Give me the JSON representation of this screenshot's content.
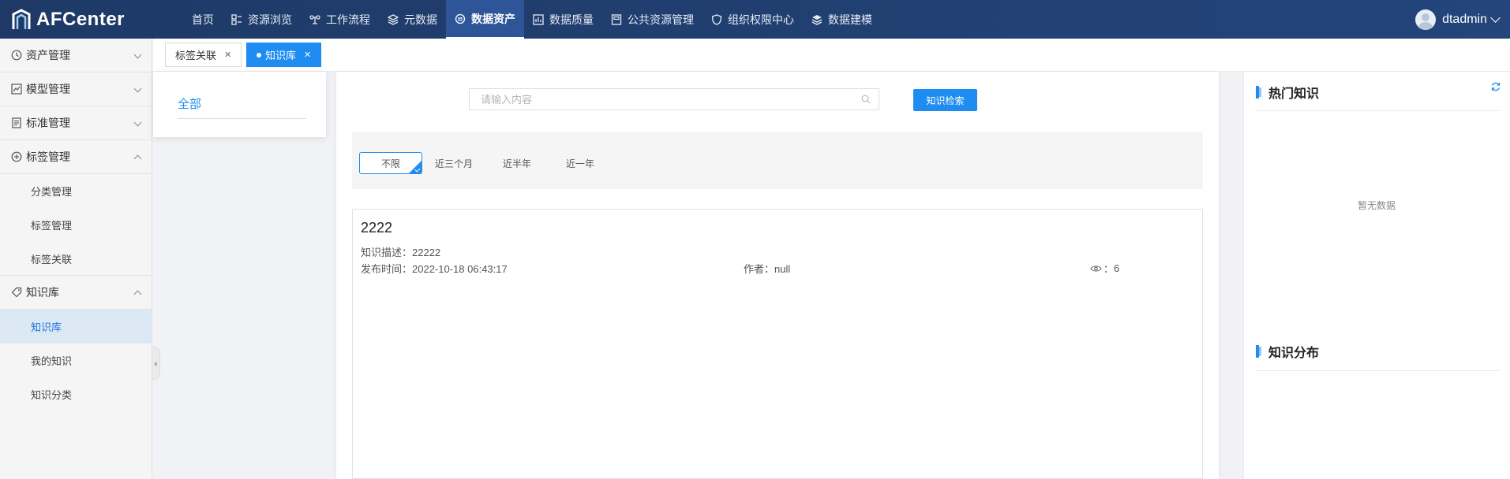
{
  "app": {
    "name": "AFCenter"
  },
  "nav": [
    {
      "label": "首页",
      "icon": ""
    },
    {
      "label": "资源浏览",
      "icon": "resource-icon"
    },
    {
      "label": "工作流程",
      "icon": "workflow-icon"
    },
    {
      "label": "元数据",
      "icon": "layers-icon"
    },
    {
      "label": "数据资产",
      "icon": "asset-icon",
      "active": true
    },
    {
      "label": "数据质量",
      "icon": "quality-icon"
    },
    {
      "label": "公共资源管理",
      "icon": "public-resource-icon"
    },
    {
      "label": "组织权限中心",
      "icon": "shield-icon"
    },
    {
      "label": "数据建模",
      "icon": "modeling-icon"
    }
  ],
  "user": {
    "name": "dtadmin"
  },
  "sidebar": {
    "groups": [
      {
        "label": "资产管理",
        "icon": "clock-icon",
        "expanded": false
      },
      {
        "label": "模型管理",
        "icon": "chart-icon",
        "expanded": false
      },
      {
        "label": "标准管理",
        "icon": "document-icon",
        "expanded": false
      },
      {
        "label": "标签管理",
        "icon": "plus-circle-icon",
        "expanded": true,
        "children": [
          "分类管理",
          "标签管理",
          "标签关联"
        ]
      },
      {
        "label": "知识库",
        "icon": "tag-icon",
        "expanded": true,
        "children": [
          "知识库",
          "我的知识",
          "知识分类"
        ],
        "active_child": "知识库"
      }
    ]
  },
  "tabs": [
    {
      "label": "标签关联",
      "active": false
    },
    {
      "label": "知识库",
      "active": true
    }
  ],
  "category": {
    "all": "全部"
  },
  "search": {
    "placeholder": "请输入内容",
    "value": "",
    "button": "知识检索"
  },
  "filters": [
    {
      "label": "不限",
      "active": true
    },
    {
      "label": "近三个月",
      "active": false
    },
    {
      "label": "近半年",
      "active": false
    },
    {
      "label": "近一年",
      "active": false
    }
  ],
  "knowledge": [
    {
      "title": "2222",
      "desc_label": "知识描述：",
      "desc": "22222",
      "time_label": "发布时间：",
      "time": "2022-10-18 06:43:17",
      "author_label": "作者：",
      "author": "null",
      "views_label": "：",
      "views": "6"
    }
  ],
  "right": {
    "hot_title": "热门知识",
    "empty": "暂无数据",
    "dist_title": "知识分布"
  },
  "colors": {
    "topbar": "#1e3966",
    "accent": "#1e8cf0",
    "active_nav": "#2d5597"
  }
}
